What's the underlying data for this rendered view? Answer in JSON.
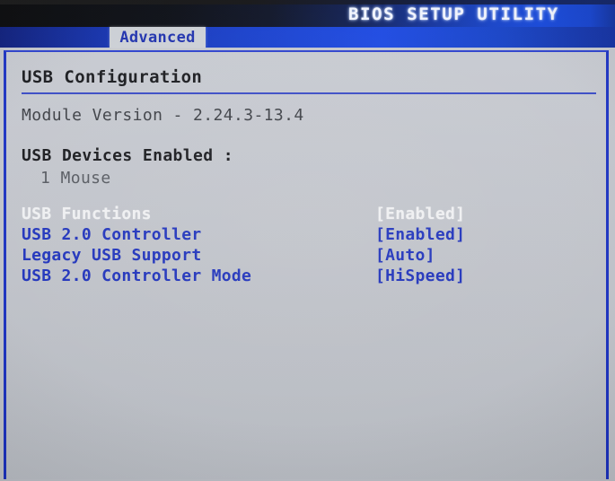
{
  "header": {
    "title": "BIOS SETUP UTILITY",
    "tabs": [
      {
        "label": "Advanced",
        "active": true
      }
    ]
  },
  "content": {
    "section_title": "USB Configuration",
    "module_version": "Module Version - 2.24.3-13.4",
    "devices_enabled_label": "USB Devices Enabled :",
    "devices_enabled_items": [
      "1 Mouse"
    ],
    "settings": [
      {
        "label": "USB Functions",
        "value": "[Enabled]",
        "state": "disabled"
      },
      {
        "label": "USB 2.0 Controller",
        "value": "[Enabled]",
        "state": "normal"
      },
      {
        "label": "Legacy USB Support",
        "value": "[Auto]",
        "state": "normal"
      },
      {
        "label": "USB 2.0 Controller Mode",
        "value": "[HiSpeed]",
        "state": "normal"
      }
    ]
  },
  "colors": {
    "accent_blue": "#1f33c0",
    "title_band_blue": "#1346dc",
    "panel_bg": "#c4c7ce",
    "tab_bg": "#ccd0d6",
    "text_dark": "#17181c",
    "text_muted": "#565a61",
    "text_disabled": "#f4f5f7"
  }
}
